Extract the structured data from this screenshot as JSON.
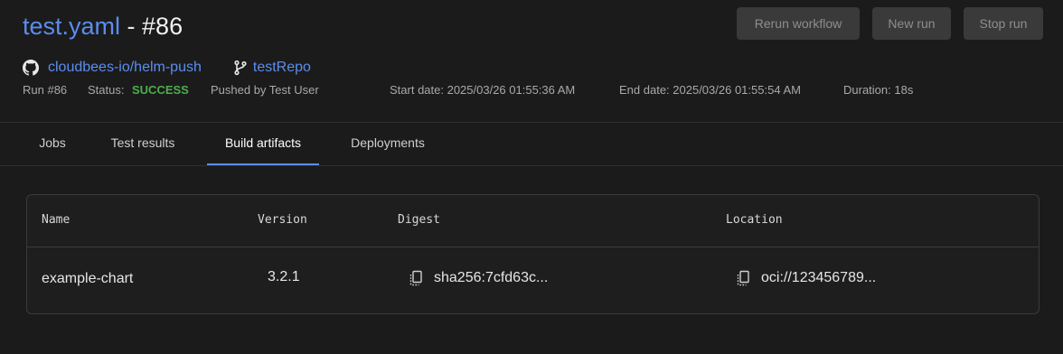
{
  "header": {
    "file_name": "test.yaml",
    "separator": " - ",
    "run_number": "#86",
    "actions": {
      "rerun": "Rerun workflow",
      "new_run": "New run",
      "stop_run": "Stop run"
    },
    "repo_link": "cloudbees-io/helm-push",
    "component_link": "testRepo",
    "meta": {
      "run": "Run #86",
      "status_label": "Status:",
      "status_value": "SUCCESS",
      "pushed_by": "Pushed by Test User",
      "start_date": "Start date: 2025/03/26 01:55:36 AM",
      "end_date": "End date: 2025/03/26 01:55:54 AM",
      "duration": "Duration: 18s"
    }
  },
  "tabs": [
    {
      "label": "Jobs"
    },
    {
      "label": "Test results"
    },
    {
      "label": "Build artifacts",
      "active": true
    },
    {
      "label": "Deployments"
    }
  ],
  "table": {
    "columns": [
      "Name",
      "Version",
      "Digest",
      "Location"
    ],
    "rows": [
      {
        "name": "example-chart",
        "version": "3.2.1",
        "digest": "sha256:7cfd63c...",
        "location": "oci://123456789..."
      }
    ]
  },
  "colors": {
    "background": "#1b1b1b",
    "accent": "#5b8def",
    "success": "#4cae4c",
    "button_bg": "#3a3a3a"
  },
  "icons": {
    "repo": "github-icon",
    "component": "git-branch-icon",
    "copy": "copy-icon"
  }
}
